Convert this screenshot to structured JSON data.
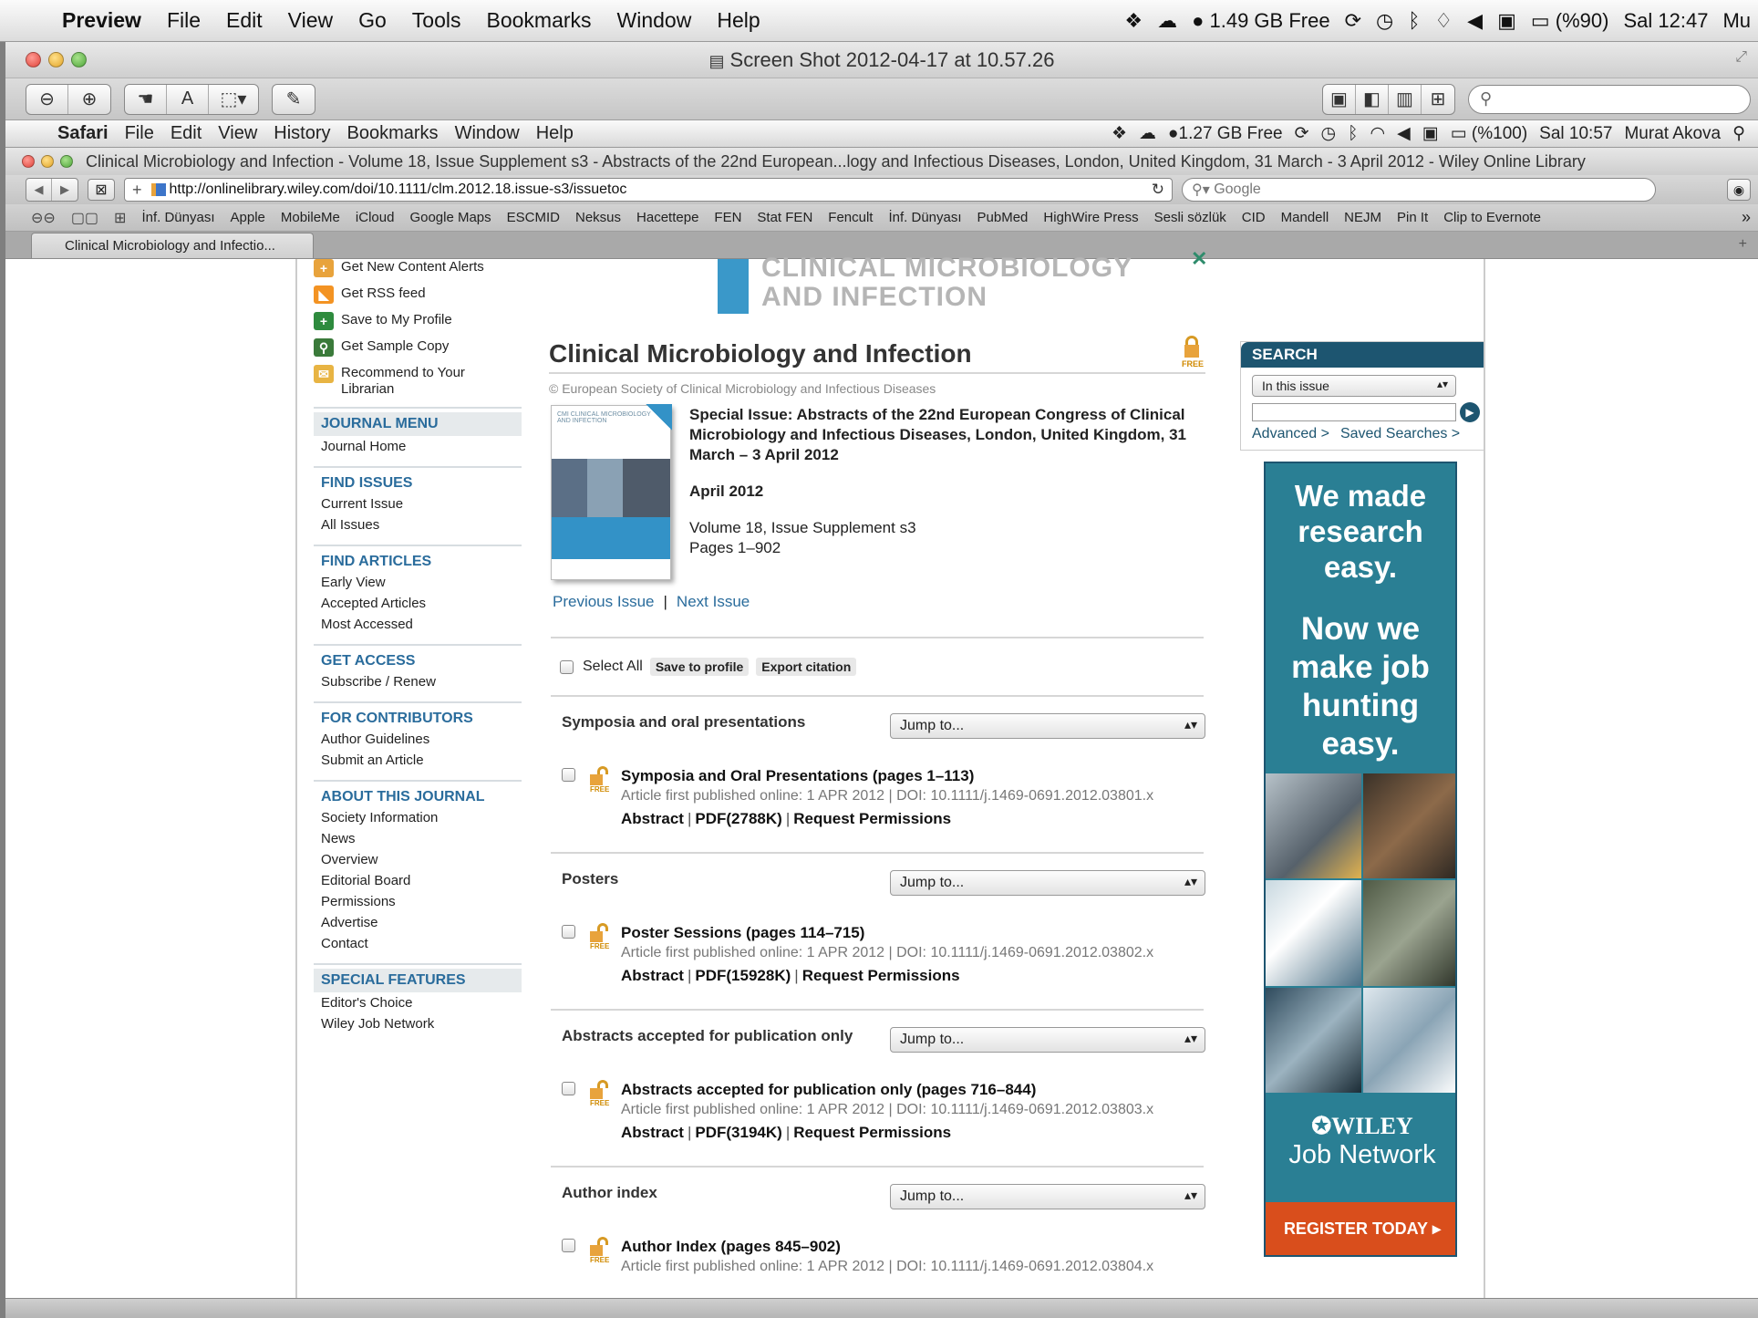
{
  "os_menubar": {
    "app": "Preview",
    "items": [
      "File",
      "Edit",
      "View",
      "Go",
      "Tools",
      "Bookmarks",
      "Window",
      "Help"
    ],
    "memory": "1.49 GB Free",
    "battery": "(%90)",
    "clock": "Sal 12:47",
    "user_truncated": "Mu"
  },
  "preview_window": {
    "title": "Screen Shot 2012-04-17 at 10.57.26"
  },
  "inner_menubar": {
    "app": "Safari",
    "items": [
      "File",
      "Edit",
      "View",
      "History",
      "Bookmarks",
      "Window",
      "Help"
    ],
    "memory": "1.27 GB Free",
    "battery": "(%100)",
    "clock": "Sal 10:57",
    "user": "Murat Akova"
  },
  "safari": {
    "window_title": "Clinical Microbiology and Infection - Volume 18, Issue Supplement s3 - Abstracts of the 22nd European...logy and Infectious Diseases, London, United Kingdom, 31 March - 3 April 2012 - Wiley Online Library",
    "url": "http://onlinelibrary.wiley.com/doi/10.1111/clm.2012.18.issue-s3/issuetoc",
    "search_placeholder": "Google",
    "bookmarks": [
      "İnf. Dünyası",
      "Apple",
      "MobileMe",
      "iCloud",
      "Google Maps",
      "ESCMID",
      "Neksus",
      "Hacettepe",
      "FEN",
      "Stat FEN",
      "Fencult",
      "İnf. Dünyası",
      "PubMed",
      "HighWire Press",
      "Sesli sözlük",
      "CID",
      "Mandell",
      "NEJM",
      "Pin It",
      "Clip to Evernote"
    ],
    "tab_label": "Clinical Microbiology and Infectio..."
  },
  "sidebar": {
    "tools": [
      {
        "icon": "plus-icon",
        "label": "Get New Content Alerts"
      },
      {
        "icon": "rss-icon",
        "label": "Get RSS feed"
      },
      {
        "icon": "save-profile-icon",
        "label": "Save to My Profile"
      },
      {
        "icon": "sample-copy-icon",
        "label": "Get Sample Copy"
      },
      {
        "icon": "recommend-icon",
        "label": "Recommend to Your Librarian"
      }
    ],
    "journal_menu": {
      "heading": "JOURNAL MENU",
      "items": [
        "Journal Home"
      ]
    },
    "find_issues": {
      "heading": "FIND ISSUES",
      "items": [
        "Current Issue",
        "All Issues"
      ]
    },
    "find_articles": {
      "heading": "FIND ARTICLES",
      "items": [
        "Early View",
        "Accepted Articles",
        "Most Accessed"
      ]
    },
    "get_access": {
      "heading": "GET ACCESS",
      "items": [
        "Subscribe / Renew"
      ]
    },
    "for_contributors": {
      "heading": "FOR CONTRIBUTORS",
      "items": [
        "Author Guidelines",
        "Submit an Article"
      ]
    },
    "about": {
      "heading": "ABOUT THIS JOURNAL",
      "items": [
        "Society Information",
        "News",
        "Overview",
        "Editorial Board",
        "Permissions",
        "Advertise",
        "Contact"
      ]
    },
    "special": {
      "heading": "SPECIAL FEATURES",
      "items": [
        "Editor's Choice",
        "Wiley Job Network"
      ]
    }
  },
  "main": {
    "logo_line1": "CLINICAL MICROBIOLOGY",
    "logo_line2": "AND INFECTION",
    "free_label": "FREE",
    "title": "Clinical Microbiology and Infection",
    "copyright": "© European Society of Clinical Microbiology and Infectious Diseases",
    "cover_text": "CMI CLINICAL MICROBIOLOGY AND INFECTION",
    "special_issue": "Special Issue: Abstracts of the 22nd European Congress of Clinical Microbiology and Infectious Diseases, London, United Kingdom, 31 March – 3 April 2012",
    "date": "April 2012",
    "volume": "Volume 18, Issue Supplement s3",
    "pages": "Pages 1–902",
    "prev_issue": "Previous Issue",
    "next_issue": "Next Issue",
    "select_all": "Select All",
    "save_to_profile": "Save to profile",
    "export_citation": "Export citation",
    "jump_label": "Jump to...",
    "sections": [
      {
        "heading": "Symposia and oral presentations",
        "title": "Symposia and Oral Presentations (pages 1–113)",
        "pub": "Article first published online: 1 APR 2012 | DOI: 10.1111/j.1469-0691.2012.03801.x",
        "pdf": "PDF(2788K)"
      },
      {
        "heading": "Posters",
        "title": "Poster Sessions (pages 114–715)",
        "pub": "Article first published online: 1 APR 2012 | DOI: 10.1111/j.1469-0691.2012.03802.x",
        "pdf": "PDF(15928K)"
      },
      {
        "heading": "Abstracts accepted for publication only",
        "title": "Abstracts accepted for publication only (pages 716–844)",
        "pub": "Article first published online: 1 APR 2012 | DOI: 10.1111/j.1469-0691.2012.03803.x",
        "pdf": "PDF(3194K)"
      },
      {
        "heading": "Author index",
        "title": "Author Index (pages 845–902)",
        "pub": "Article first published online: 1 APR 2012 | DOI: 10.1111/j.1469-0691.2012.03804.x",
        "pdf": ""
      }
    ],
    "abstract_label": "Abstract",
    "permissions_label": "Request Permissions"
  },
  "right": {
    "search_heading": "SEARCH",
    "scope": "In this issue",
    "advanced": "Advanced >",
    "saved": "Saved Searches >",
    "ad_line1": "We made research easy.",
    "ad_line2": "Now we make job hunting easy.",
    "ad_brand": "WILEY",
    "ad_brand2": "Job Network",
    "ad_cta": "REGISTER TODAY"
  }
}
